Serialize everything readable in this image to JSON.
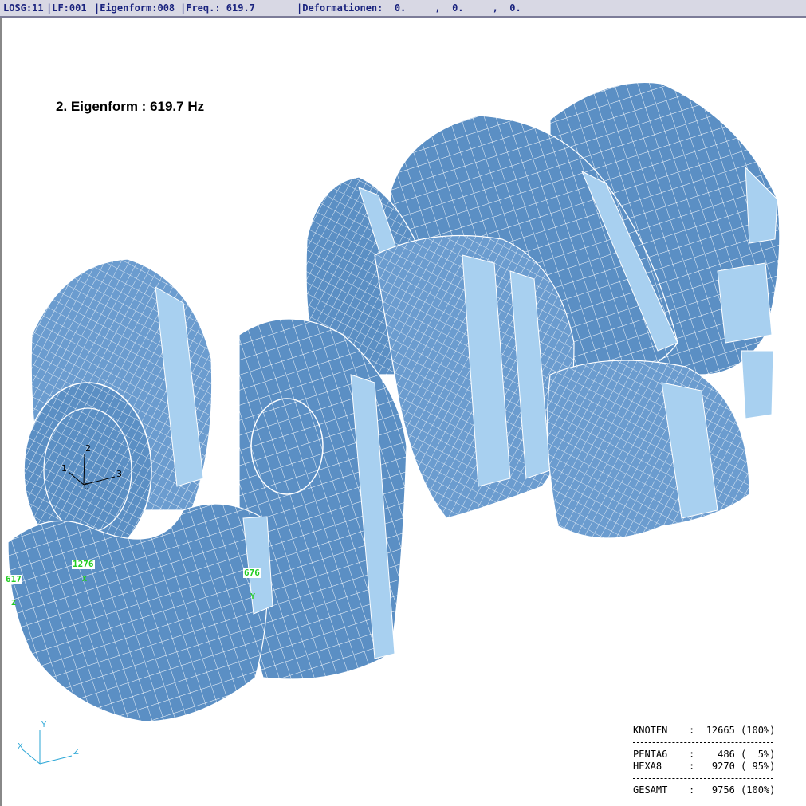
{
  "statusbar": {
    "losg": "LOSG:11",
    "lf": "|LF:001",
    "eigenform": "|Eigenform:008",
    "freq": "|Freq.: 619.7",
    "deformationen": "|Deformationen:  0.     ,  0.     ,  0."
  },
  "view": {
    "title": "2. Eigenform : 619.7 Hz"
  },
  "nodes": [
    {
      "id": "617",
      "axis": "Z"
    },
    {
      "id": "1276",
      "axis": "X"
    },
    {
      "id": "676",
      "axis": "Y"
    }
  ],
  "local_axes": {
    "one": "1",
    "two": "2",
    "three": "3",
    "origin": "0"
  },
  "triad": {
    "x": "X",
    "y": "Y",
    "z": "Z"
  },
  "stats": {
    "knoten_label": "KNOTEN",
    "knoten_value": "12665 (100%)",
    "penta6_label": "PENTA6",
    "penta6_value": "  486 (  5%)",
    "hexa8_label": "HEXA8",
    "hexa8_value": " 9270 ( 95%)",
    "gesamt_label": "GESAMT",
    "gesamt_value": " 9756 (100%)"
  },
  "colors": {
    "mesh_fill": "#5b8fc4",
    "mesh_light": "#a8d0f0",
    "mesh_dark": "#3d6ea3",
    "mesh_line": "#ffffff",
    "node_label": "#22cc22",
    "status_text": "#1a237e",
    "triad": "#2aa6d6"
  }
}
